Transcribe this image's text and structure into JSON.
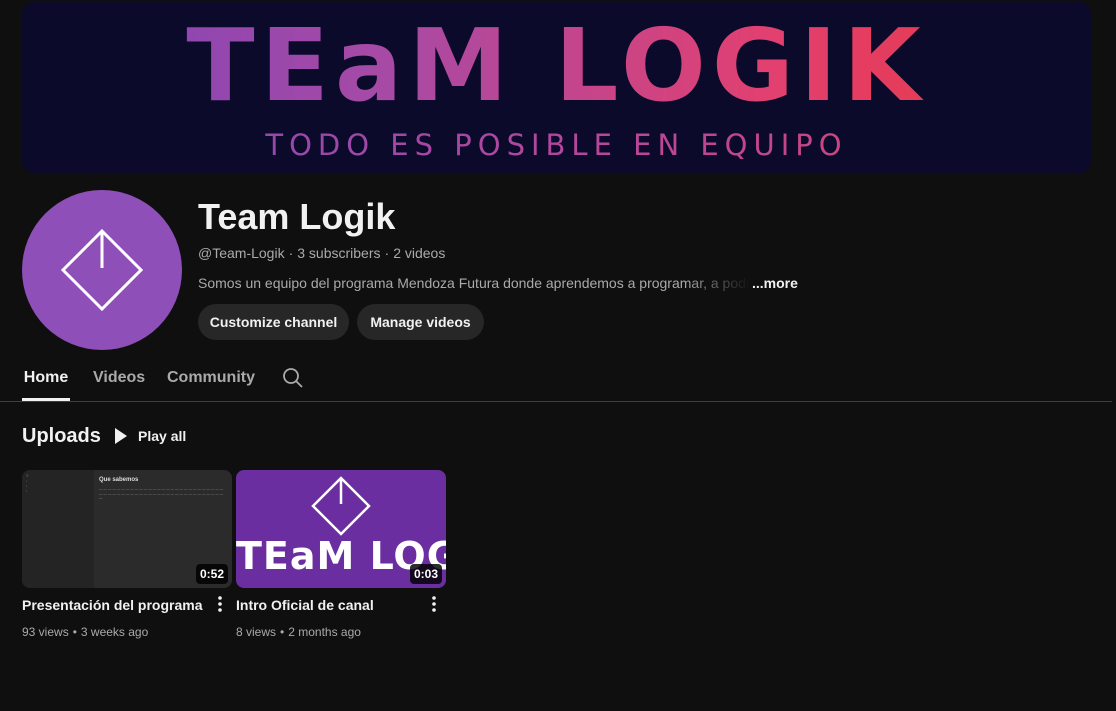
{
  "banner": {
    "title": "TEaM LOGIK",
    "tagline": "TODO ES POSIBLE EN EQUIPO"
  },
  "channel": {
    "name": "Team Logik",
    "handle": "@Team-Logik",
    "subscribers": "3 subscribers",
    "videos": "2 videos",
    "description": "Somos un equipo del programa Mendoza Futura donde aprendemos a programar, a poder",
    "more_label": "...more",
    "avatar_icon": "diamond-logo-icon",
    "avatar_color": "#8f4fb8"
  },
  "actions": {
    "customize_label": "Customize channel",
    "manage_label": "Manage videos"
  },
  "tabs": [
    {
      "label": "Home",
      "active": true
    },
    {
      "label": "Videos",
      "active": false
    },
    {
      "label": "Community",
      "active": false
    }
  ],
  "uploads": {
    "title": "Uploads",
    "play_all_label": "Play all",
    "videos": [
      {
        "title": "Presentación del programa",
        "duration": "0:52",
        "views": "93 views",
        "age": "3 weeks ago",
        "thumb_heading": "Que sabemos"
      },
      {
        "title": "Intro Oficial de canal",
        "duration": "0:03",
        "views": "8 views",
        "age": "2 months ago",
        "thumb_text": "TEaM LOGIK"
      }
    ]
  },
  "colors": {
    "background": "#0f0f0f",
    "chip": "#272727",
    "text_secondary": "#aaaaaa",
    "thumb_purple": "#6a2ea0"
  }
}
